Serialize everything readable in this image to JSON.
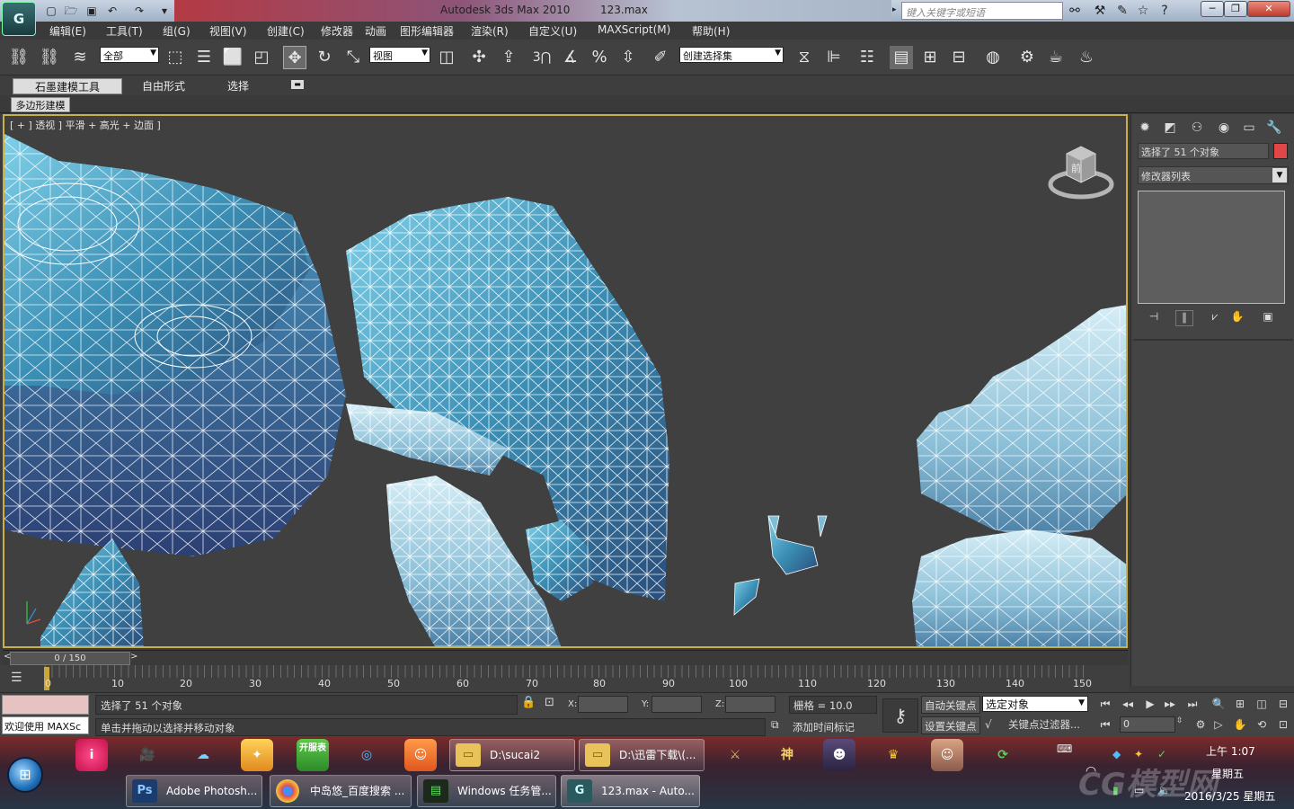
{
  "titlebar": {
    "app_title": "Autodesk 3ds Max  2010",
    "file_name": "123.max",
    "search_placeholder": "键入关键字或短语"
  },
  "menu": [
    "编辑(E)",
    "工具(T)",
    "组(G)",
    "视图(V)",
    "创建(C)",
    "修改器",
    "动画",
    "图形编辑器",
    "渲染(R)",
    "自定义(U)",
    "MAXScript(M)",
    "帮助(H)"
  ],
  "toolbar": {
    "filter_value": "全部",
    "refcoord_value": "视图",
    "selection_set_value": "创建选择集",
    "snap_label": "3"
  },
  "ribbon": {
    "tabs": [
      "石墨建模工具",
      "自由形式",
      "选择"
    ],
    "subtab": "多边形建模"
  },
  "viewport": {
    "label": "[ + ] 透视 ] 平滑 + 高光 + 边面 ]",
    "viewcube_face": "前"
  },
  "command_panel": {
    "selection_field": "选择了 51 个对象",
    "modifier_list": "修改器列表",
    "swatch_color": "#e34646"
  },
  "timeline": {
    "slider_text": "0 / 150",
    "tick_labels": [
      "0",
      "10",
      "20",
      "30",
      "40",
      "50",
      "60",
      "70",
      "80",
      "90",
      "100",
      "110",
      "120",
      "130",
      "140",
      "150"
    ]
  },
  "status": {
    "maxscript_text": "欢迎使用 MAXSc",
    "selection_status": "选择了 51 个对象",
    "prompt": "单击并拖动以选择并移动对象",
    "x_label": "X:",
    "y_label": "Y:",
    "z_label": "Z:",
    "grid": "栅格 = 10.0",
    "add_time_tag": "添加时间标记",
    "auto_key": "自动关键点",
    "set_key": "设置关键点",
    "key_mode_value": "选定对象",
    "key_filters": "关键点过滤器...",
    "frame_value": "0"
  },
  "taskbar": {
    "row1": [
      "D:\\sucai2",
      "D:\\迅雷下载\\(..."
    ],
    "row2": [
      "Adobe Photosh...",
      "中岛悠_百度搜索 ...",
      "Windows 任务管...",
      "123.max - Auto..."
    ],
    "app_icons": [
      "开服表"
    ],
    "clock_time": "上午 1:07",
    "clock_day": "星期五",
    "clock_date": "2016/3/25 星期五",
    "watermark": "CG模型网"
  }
}
